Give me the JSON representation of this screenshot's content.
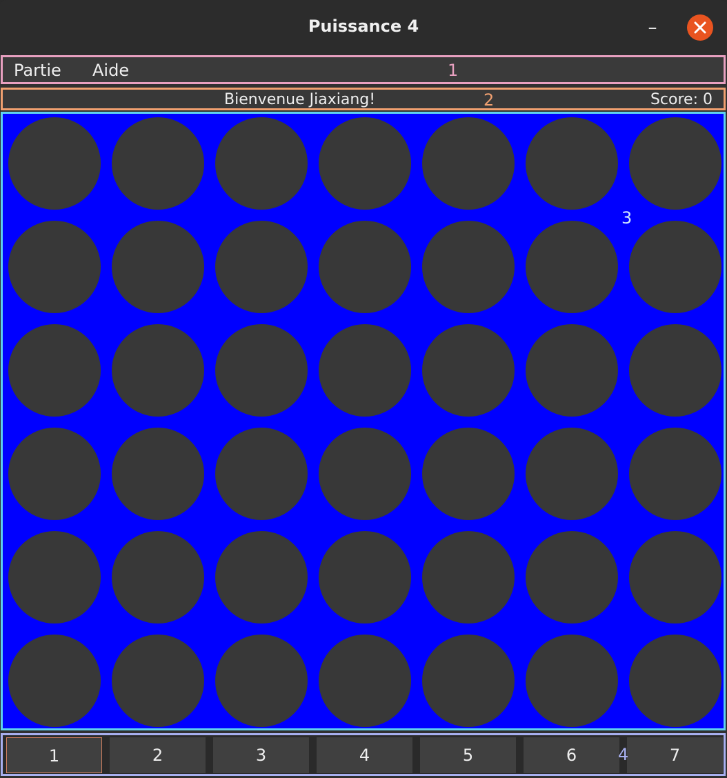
{
  "window": {
    "title": "Puissance 4",
    "minimize_glyph": "–"
  },
  "menubar": {
    "items": [
      "Partie",
      "Aide"
    ],
    "annotation": "1"
  },
  "status": {
    "welcome": "Bienvenue Jiaxiang!",
    "score": "Score: 0",
    "annotation": "2"
  },
  "board": {
    "rows": 6,
    "cols": 7,
    "annotation": "3",
    "cells": [
      [
        "empty",
        "empty",
        "empty",
        "empty",
        "empty",
        "empty",
        "empty"
      ],
      [
        "empty",
        "empty",
        "empty",
        "empty",
        "empty",
        "empty",
        "empty"
      ],
      [
        "empty",
        "empty",
        "empty",
        "empty",
        "empty",
        "empty",
        "empty"
      ],
      [
        "empty",
        "empty",
        "empty",
        "empty",
        "empty",
        "empty",
        "empty"
      ],
      [
        "empty",
        "empty",
        "empty",
        "empty",
        "empty",
        "empty",
        "empty"
      ],
      [
        "empty",
        "empty",
        "empty",
        "empty",
        "empty",
        "empty",
        "empty"
      ]
    ]
  },
  "column_buttons": {
    "labels": [
      "1",
      "2",
      "3",
      "4",
      "5",
      "6",
      "7"
    ],
    "annotation": "4"
  },
  "colors": {
    "board": "#0000ff",
    "empty_slot": "#383838",
    "close_button": "#e95420",
    "annotation_1": "#e8a0c0",
    "annotation_2": "#f0a070",
    "annotation_3": "#5fd0f0",
    "annotation_4": "#a8b0f0"
  },
  "icons": {
    "close": "close-icon",
    "minimize": "minimize-icon"
  }
}
